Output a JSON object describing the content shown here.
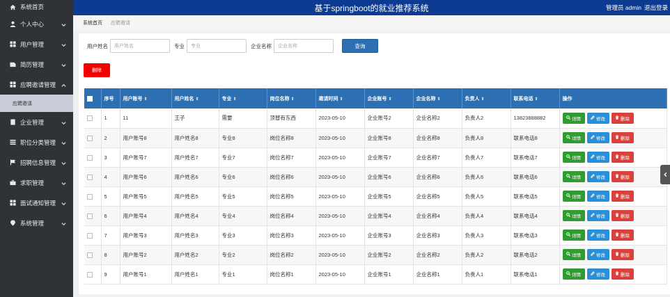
{
  "app": {
    "title": "基于springboot的就业推荐系统",
    "user_label": "管理员 admin",
    "logout_label": "退出登录"
  },
  "sidebar": {
    "items": [
      {
        "label": "系统首页",
        "icon": "home-icon"
      },
      {
        "label": "个人中心",
        "icon": "user-icon"
      },
      {
        "label": "用户管理",
        "icon": "grid-icon"
      },
      {
        "label": "简历管理",
        "icon": "document-icon"
      },
      {
        "label": "应聘邀请管理",
        "icon": "grid-icon",
        "expanded": true
      },
      {
        "label": "企业管理",
        "icon": "building-icon"
      },
      {
        "label": "职位分类管理",
        "icon": "list-icon"
      },
      {
        "label": "招聘信息管理",
        "icon": "flag-icon"
      },
      {
        "label": "求职管理",
        "icon": "briefcase-icon"
      },
      {
        "label": "面试通知管理",
        "icon": "grid-icon"
      },
      {
        "label": "系统管理",
        "icon": "pin-icon"
      }
    ],
    "sub_item": "应聘邀请"
  },
  "breadcrumb": {
    "home": "系统首页",
    "current": "应聘邀请"
  },
  "search": {
    "user_name_label": "用户姓名",
    "user_name_placeholder": "用户姓名",
    "major_label": "专业",
    "major_placeholder": "专业",
    "company_label": "企业名称",
    "company_placeholder": "企业名称",
    "button_label": "查询"
  },
  "delete_button": "删除",
  "table": {
    "headers": [
      "序号",
      "用户账号",
      "用户姓名",
      "专业",
      "岗位名称",
      "邀请时间",
      "企业账号",
      "企业名称",
      "负责人",
      "联系电话",
      "操作"
    ],
    "rows": [
      {
        "no": "1",
        "account": "11",
        "name": "王子",
        "major": "需要",
        "post": "顶替有东西",
        "time": "2023-05-10",
        "company_account": "企业账号2",
        "company_name": "企业名称2",
        "manager": "负责人2",
        "phone": "13823888882"
      },
      {
        "no": "2",
        "account": "用户账号8",
        "name": "用户姓名8",
        "major": "专业8",
        "post": "岗位名称8",
        "time": "2023-05-10",
        "company_account": "企业账号8",
        "company_name": "企业名称8",
        "manager": "负责人8",
        "phone": "联系电话8"
      },
      {
        "no": "3",
        "account": "用户账号7",
        "name": "用户姓名7",
        "major": "专业7",
        "post": "岗位名称7",
        "time": "2023-05-10",
        "company_account": "企业账号7",
        "company_name": "企业名称7",
        "manager": "负责人7",
        "phone": "联系电话7"
      },
      {
        "no": "4",
        "account": "用户账号6",
        "name": "用户姓名6",
        "major": "专业6",
        "post": "岗位名称6",
        "time": "2023-05-10",
        "company_account": "企业账号6",
        "company_name": "企业名称6",
        "manager": "负责人6",
        "phone": "联系电话6"
      },
      {
        "no": "5",
        "account": "用户账号5",
        "name": "用户姓名5",
        "major": "专业5",
        "post": "岗位名称5",
        "time": "2023-05-10",
        "company_account": "企业账号5",
        "company_name": "企业名称5",
        "manager": "负责人5",
        "phone": "联系电话5"
      },
      {
        "no": "6",
        "account": "用户账号4",
        "name": "用户姓名4",
        "major": "专业4",
        "post": "岗位名称4",
        "time": "2023-05-10",
        "company_account": "企业账号4",
        "company_name": "企业名称4",
        "manager": "负责人4",
        "phone": "联系电话4"
      },
      {
        "no": "7",
        "account": "用户账号3",
        "name": "用户姓名3",
        "major": "专业3",
        "post": "岗位名称3",
        "time": "2023-05-10",
        "company_account": "企业账号3",
        "company_name": "企业名称3",
        "manager": "负责人3",
        "phone": "联系电话3"
      },
      {
        "no": "8",
        "account": "用户账号2",
        "name": "用户姓名2",
        "major": "专业2",
        "post": "岗位名称2",
        "time": "2023-05-10",
        "company_account": "企业账号2",
        "company_name": "企业名称2",
        "manager": "负责人2",
        "phone": "联系电话2"
      },
      {
        "no": "9",
        "account": "用户账号1",
        "name": "用户姓名1",
        "major": "专业1",
        "post": "岗位名称1",
        "time": "2023-05-10",
        "company_account": "企业账号1",
        "company_name": "企业名称1",
        "manager": "负责人1",
        "phone": "联系电话1"
      }
    ],
    "actions": {
      "detail": "详情",
      "edit": "修改",
      "delete": "删除"
    }
  },
  "colors": {
    "header": "#0d3b91",
    "sidebar": "#2f3336",
    "table_header": "#2d6fb3",
    "detail": "#2e9c2e",
    "edit": "#2a8fd6",
    "delete": "#d9423c",
    "bulk_delete": "#f20000"
  }
}
